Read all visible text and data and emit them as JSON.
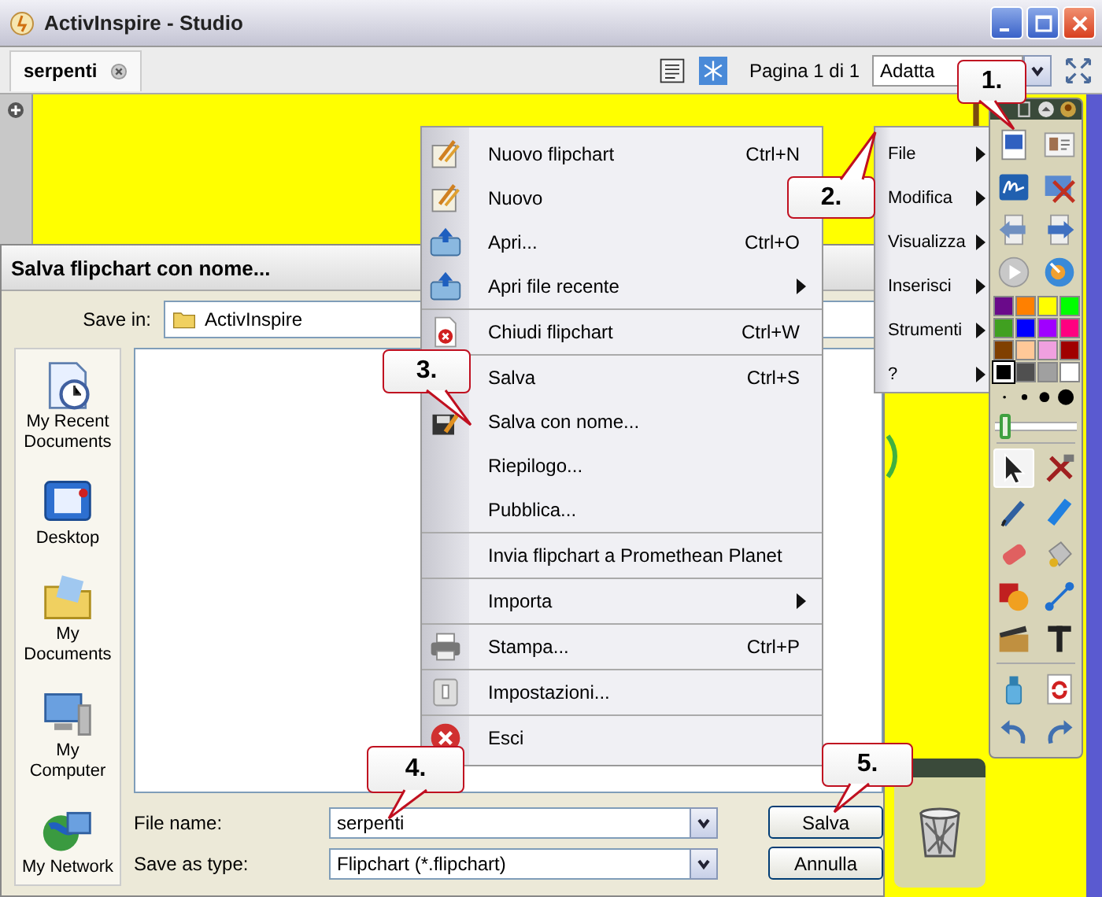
{
  "window": {
    "title": "ActivInspire - Studio"
  },
  "document_tab": {
    "label": "serpenti"
  },
  "page_indicator": "Pagina 1 di 1",
  "zoom_select": {
    "value": "Adatta"
  },
  "save_dialog": {
    "title": "Salva flipchart con nome...",
    "save_in_label": "Save in:",
    "save_in_value": "ActivInspire",
    "places": [
      {
        "label": "My Recent Documents"
      },
      {
        "label": "Desktop"
      },
      {
        "label": "My Documents"
      },
      {
        "label": "My Computer"
      },
      {
        "label": "My Network"
      }
    ],
    "file_name_label": "File name:",
    "file_name_value": "serpenti",
    "save_as_type_label": "Save as type:",
    "save_as_type_value": "Flipchart (*.flipchart)",
    "buttons": [
      "Salva",
      "Annulla"
    ]
  },
  "file_menu": [
    {
      "label": "Nuovo flipchart",
      "shortcut": "Ctrl+N",
      "separator_before": false
    },
    {
      "label": "Nuovo",
      "separator_before": false
    },
    {
      "label": "Apri...",
      "shortcut": "Ctrl+O",
      "separator_before": false
    },
    {
      "label": "Apri file recente",
      "submenu": true,
      "separator_before": false
    },
    {
      "label": "Chiudi flipchart",
      "shortcut": "Ctrl+W",
      "separator_before": true
    },
    {
      "label": "Salva",
      "shortcut": "Ctrl+S",
      "separator_before": true
    },
    {
      "label": "Salva con nome...",
      "separator_before": false
    },
    {
      "label": "Riepilogo...",
      "separator_before": false
    },
    {
      "label": "Pubblica...",
      "separator_before": false
    },
    {
      "label": "Invia flipchart a Promethean Planet",
      "separator_before": true
    },
    {
      "label": "Importa",
      "submenu": true,
      "separator_before": true
    },
    {
      "label": "Stampa...",
      "shortcut": "Ctrl+P",
      "separator_before": true
    },
    {
      "label": "Impostazioni...",
      "separator_before": true
    },
    {
      "label": "Esci",
      "separator_before": true
    }
  ],
  "main_menu": [
    {
      "label": "File",
      "submenu": true
    },
    {
      "label": "Modifica",
      "submenu": true
    },
    {
      "label": "Visualizza",
      "submenu": true
    },
    {
      "label": "Inserisci",
      "submenu": true
    },
    {
      "label": "Strumenti",
      "submenu": true
    },
    {
      "label": "?",
      "submenu": true
    }
  ],
  "toolbox": {
    "top_tools": [
      {
        "kind": "page-browser"
      },
      {
        "kind": "profile"
      },
      {
        "kind": "signature"
      },
      {
        "kind": "desktop-tools"
      },
      {
        "kind": "prev"
      },
      {
        "kind": "next"
      },
      {
        "kind": "play"
      },
      {
        "kind": "help"
      }
    ],
    "palette": [
      {
        "color": "#6a0a8a",
        "selected": false
      },
      {
        "color": "#ff8000",
        "selected": false
      },
      {
        "color": "#ffff00",
        "selected": false
      },
      {
        "color": "#00ff00",
        "selected": false
      },
      {
        "color": "#40a020",
        "selected": false
      },
      {
        "color": "#0000ff",
        "selected": false
      },
      {
        "color": "#a000ff",
        "selected": false
      },
      {
        "color": "#ff0080",
        "selected": false
      },
      {
        "color": "#804000",
        "selected": false
      },
      {
        "color": "#ffc898",
        "selected": false
      },
      {
        "color": "#f0a0e0",
        "selected": false
      },
      {
        "color": "#a00000",
        "selected": false
      },
      {
        "color": "#000000",
        "selected": true
      },
      {
        "color": "#505050",
        "selected": false
      },
      {
        "color": "#a0a0a0",
        "selected": false
      },
      {
        "color": "#ffffff",
        "selected": false
      }
    ],
    "pen_width_slider": {
      "level": 0.05
    },
    "tools": [
      {
        "kind": "select",
        "selected": true
      },
      {
        "kind": "tools",
        "selected": false
      },
      {
        "kind": "pen",
        "selected": false
      },
      {
        "kind": "highlighter",
        "selected": false
      },
      {
        "kind": "eraser",
        "selected": false
      },
      {
        "kind": "fill",
        "selected": false
      },
      {
        "kind": "shape",
        "selected": false
      },
      {
        "kind": "connector",
        "selected": false
      },
      {
        "kind": "media",
        "selected": false
      },
      {
        "kind": "text",
        "selected": false
      }
    ],
    "bottom_tools": [
      {
        "kind": "clear"
      },
      {
        "kind": "reset"
      },
      {
        "kind": "undo"
      },
      {
        "kind": "redo"
      }
    ]
  },
  "callouts": [
    "1.",
    "2.",
    "3.",
    "4.",
    "5."
  ]
}
